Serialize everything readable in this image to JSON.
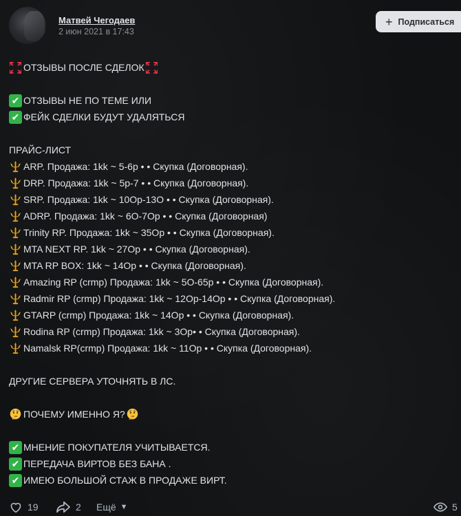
{
  "post": {
    "author": "Матвей Чегодаев",
    "date": "2 июн 2021 в 17:43",
    "subscribe_label": "Подписаться",
    "lines": [
      {
        "icon": "anger-symbol-icon",
        "text": "ОТЗЫВЫ ПОСЛЕ СДЕЛОК",
        "icon_after": "anger-symbol-icon"
      },
      {
        "gap": true
      },
      {
        "icon": "check-mark-icon",
        "text": "ОТЗЫВЫ НЕ ПО ТЕМЕ ИЛИ"
      },
      {
        "icon": "check-mark-icon",
        "text": "ФЕЙК СДЕЛКИ БУДУТ УДАЛЯТЬСЯ"
      },
      {
        "gap": true
      },
      {
        "text": "ПРАЙС-ЛИСТ"
      },
      {
        "icon": "trident-icon",
        "text": "ARP. Продажа: 1kk ~ 5-6р • • Скупка (Договорная)."
      },
      {
        "icon": "trident-icon",
        "text": "DRP. Продажа: 1kk ~ 5р-7 • • Скупка (Договорная)."
      },
      {
        "icon": "trident-icon",
        "text": "SRP. Продажа: 1kk ~ 10Ор-13О • • Скупка (Договорная)."
      },
      {
        "icon": "trident-icon",
        "text": "ADRP. Продажа: 1kk ~ 6О-7Ор • • Скупка (Договорная)"
      },
      {
        "icon": "trident-icon",
        "text": "Trinity  RP. Продажа: 1kk ~ 35Ор • • Скупка (Договорная)."
      },
      {
        "icon": "trident-icon",
        "text": "MTA  NEXT  RP. 1kk ~ 27Ор • • Скупка (Договорная)."
      },
      {
        "icon": "trident-icon",
        "text": "MTA  RP  BOX: 1kk ~ 14Ор • • Скупка (Договорная)."
      },
      {
        "icon": "trident-icon",
        "text": "Amazing  RP (crmp) Продажа: 1kk ~ 5О-65р • • Скупка (Договорная)."
      },
      {
        "icon": "trident-icon",
        "text": "Radmir  RP (crmp) Продажа: 1kk ~ 12Ор-14Ор • • Скупка (Договорная)."
      },
      {
        "icon": "trident-icon",
        "text": "GTARP (crmp) Продажа: 1kk ~ 14Ор • • Скупка (Договорная)."
      },
      {
        "icon": "trident-icon",
        "text": "Rodina  RP (crmp) Продажа: 1kk ~ 3Ор• • Скупка (Договорная)."
      },
      {
        "icon": "trident-icon",
        "text": "Namalsk  RP(crmp) Продажа: 1kk ~ 11Ор • • Скупка (Договорная)."
      },
      {
        "gap": true
      },
      {
        "text": "ДРУГИЕ СЕРВЕРА УТОЧНЯТЬ В ЛС."
      },
      {
        "gap": true
      },
      {
        "icon": "thinking-face-icon",
        "text": "ПОЧЕМУ ИМЕННО Я?",
        "icon_after": "thinking-face-icon"
      },
      {
        "gap": true
      },
      {
        "icon": "check-mark-icon",
        "text": "МНЕНИЕ ПОКУПАТЕЛЯ УЧИТЫВАЕТСЯ."
      },
      {
        "icon": "check-mark-icon",
        "text": "ПЕРЕДАЧА ВИРТОВ БЕЗ БАНА ."
      },
      {
        "icon": "check-mark-icon",
        "text": "ИМЕЮ БОЛЬШОЙ СТАЖ В ПРОДАЖЕ ВИРТ."
      }
    ]
  },
  "footer": {
    "likes": "19",
    "shares": "2",
    "more_label": "Ещё",
    "views": "5"
  },
  "colors": {
    "background": "#121212",
    "text": "#e1e3e6",
    "muted": "#8a8d91",
    "check": "#32b34a",
    "trident": "#e8a317",
    "anger": "#e0314b"
  }
}
